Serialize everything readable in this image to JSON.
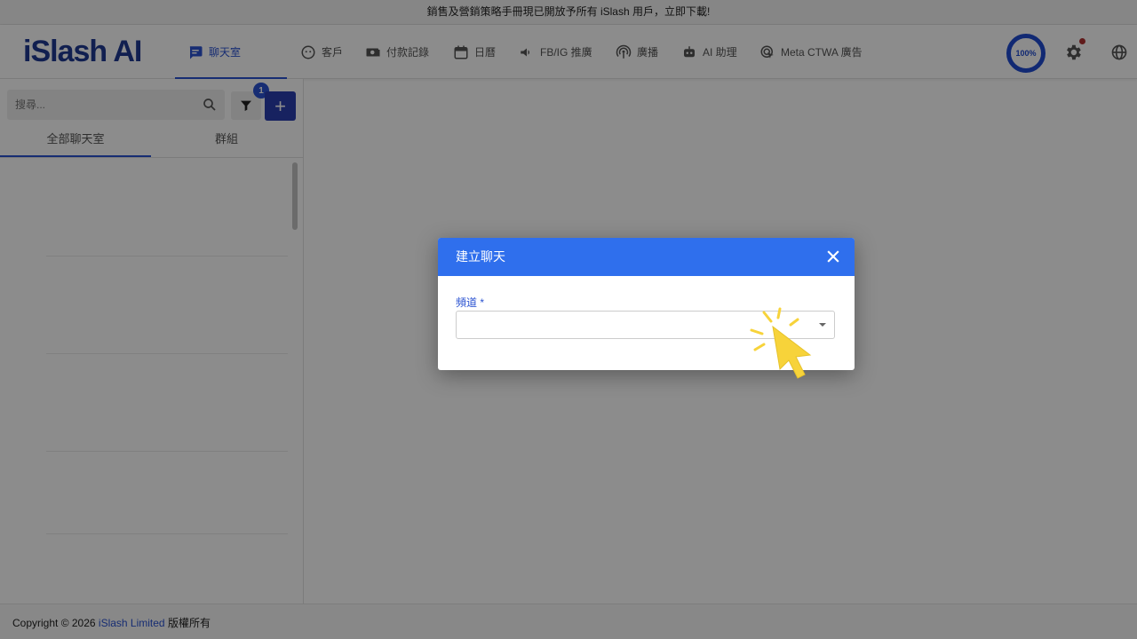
{
  "announcement": "銷售及營銷策略手冊現已開放予所有 iSlash 用戶，立即下載!",
  "brand": {
    "logo": "iSlash AI",
    "color": "#1f3a93"
  },
  "nav": [
    {
      "label": "聊天室",
      "icon": "chat-icon",
      "active": true
    },
    {
      "label": "客戶",
      "icon": "face-icon"
    },
    {
      "label": "付款記錄",
      "icon": "payment-icon"
    },
    {
      "label": "日曆",
      "icon": "calendar-icon"
    },
    {
      "label": "FB/IG 推廣",
      "icon": "megaphone-icon"
    },
    {
      "label": "廣播",
      "icon": "broadcast-icon"
    },
    {
      "label": "AI 助理",
      "icon": "robot-icon"
    },
    {
      "label": "Meta CTWA 廣告",
      "icon": "ad-click-icon"
    }
  ],
  "header_right": {
    "progress_label": "100%",
    "progress_value": 1.0
  },
  "sidebar": {
    "search_placeholder": "搜尋...",
    "filter_count": "1",
    "add_label": "+",
    "tabs": [
      {
        "label": "全部聊天室",
        "active": true
      },
      {
        "label": "群組"
      }
    ]
  },
  "dialog": {
    "title": "建立聊天",
    "field_label": "頻道 *",
    "field_value": ""
  },
  "footer": {
    "prefix": "Copyright © 2026 ",
    "company": "iSlash Limited",
    "suffix": " 版權所有"
  },
  "colors": {
    "accent": "#2a52d1",
    "dialog_header": "#2f6fed",
    "cursor": "#f7d33a"
  }
}
